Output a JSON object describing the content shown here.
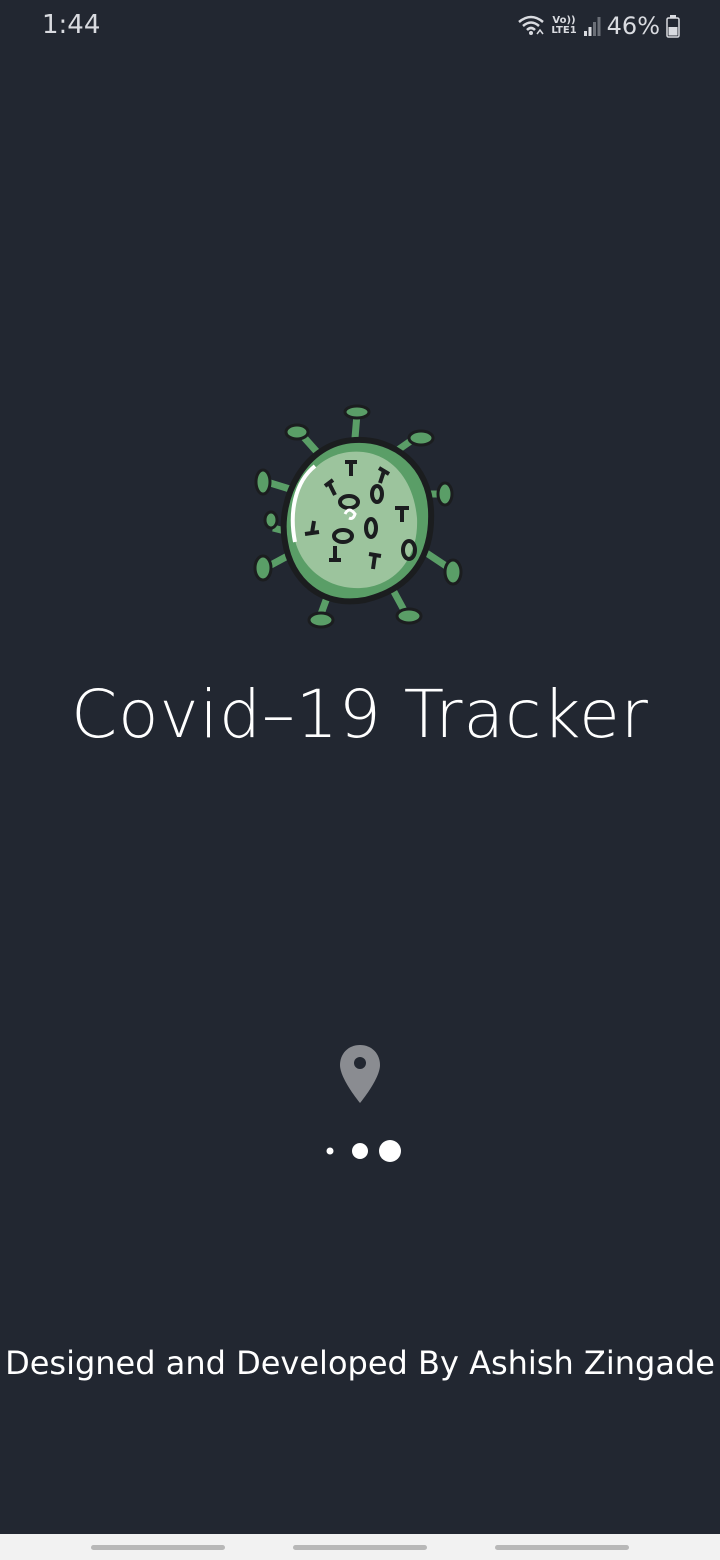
{
  "status_bar": {
    "time": "1:44",
    "network_top": "Vo))",
    "network_bottom": "LTE1",
    "battery": "46%"
  },
  "splash": {
    "title": "Covid–19 Tracker",
    "credit": "Designed and Developed By Ashish Zingade",
    "loading_dots": 3
  },
  "colors": {
    "background": "#222731",
    "virus_green": "#5a9e67",
    "virus_core": "#9cc49d",
    "pin_gray": "#8a8c91",
    "nav_bar": "#f2f2f2"
  },
  "icons": {
    "logo": "virus-icon",
    "location": "location-pin-icon",
    "wifi": "wifi-icon",
    "signal": "signal-icon",
    "battery": "battery-icon"
  }
}
